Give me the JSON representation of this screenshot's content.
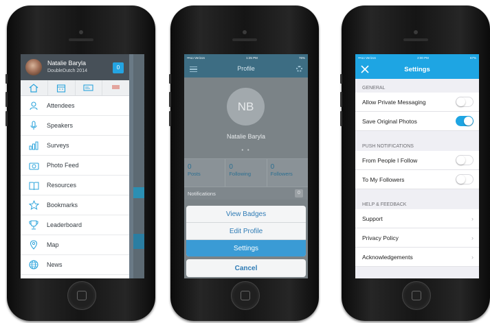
{
  "phone1": {
    "user": {
      "name": "Natalie Baryla",
      "subtitle": "DoubleDutch 2014",
      "badge": "0"
    },
    "tabs": [
      "home-icon",
      "calendar-icon",
      "card-icon",
      "flag-icon"
    ],
    "menu": [
      {
        "label": "Attendees",
        "icon": "attendees-icon"
      },
      {
        "label": "Speakers",
        "icon": "microphone-icon"
      },
      {
        "label": "Surveys",
        "icon": "surveys-icon"
      },
      {
        "label": "Photo Feed",
        "icon": "camera-icon"
      },
      {
        "label": "Resources",
        "icon": "book-icon"
      },
      {
        "label": "Bookmarks",
        "icon": "star-icon"
      },
      {
        "label": "Leaderboard",
        "icon": "trophy-icon"
      },
      {
        "label": "Map",
        "icon": "map-pin-icon"
      },
      {
        "label": "News",
        "icon": "globe-icon"
      }
    ]
  },
  "phone2": {
    "status": {
      "carrier": "•••oo Verizon",
      "time": "1:25 PM",
      "battery": "76%"
    },
    "title": "Profile",
    "initials": "NB",
    "name": "Natalie Baryla",
    "stats": [
      {
        "value": "0",
        "label": "Posts"
      },
      {
        "value": "0",
        "label": "Following"
      },
      {
        "value": "0",
        "label": "Followers"
      }
    ],
    "notifications": {
      "label": "Notifications",
      "count": "0"
    },
    "actions": {
      "view_badges": "View Badges",
      "edit_profile": "Edit Profile",
      "settings": "Settings",
      "cancel": "Cancel"
    }
  },
  "phone3": {
    "status": {
      "carrier": "•••oo Verizon",
      "time": "2:00 PM",
      "battery": "67%"
    },
    "title": "Settings",
    "sections": {
      "general": "GENERAL",
      "push": "PUSH NOTIFICATIONS",
      "help": "HELP & FEEDBACK"
    },
    "general": {
      "private_messaging": "Allow Private Messaging",
      "save_photos": "Save Original Photos"
    },
    "push": {
      "from_people": "From People I Follow",
      "to_followers": "To My Followers"
    },
    "help": {
      "support": "Support",
      "privacy": "Privacy Policy",
      "acknowledgements": "Acknowledgements"
    },
    "colors": {
      "accent": "#1ea5e3"
    }
  }
}
